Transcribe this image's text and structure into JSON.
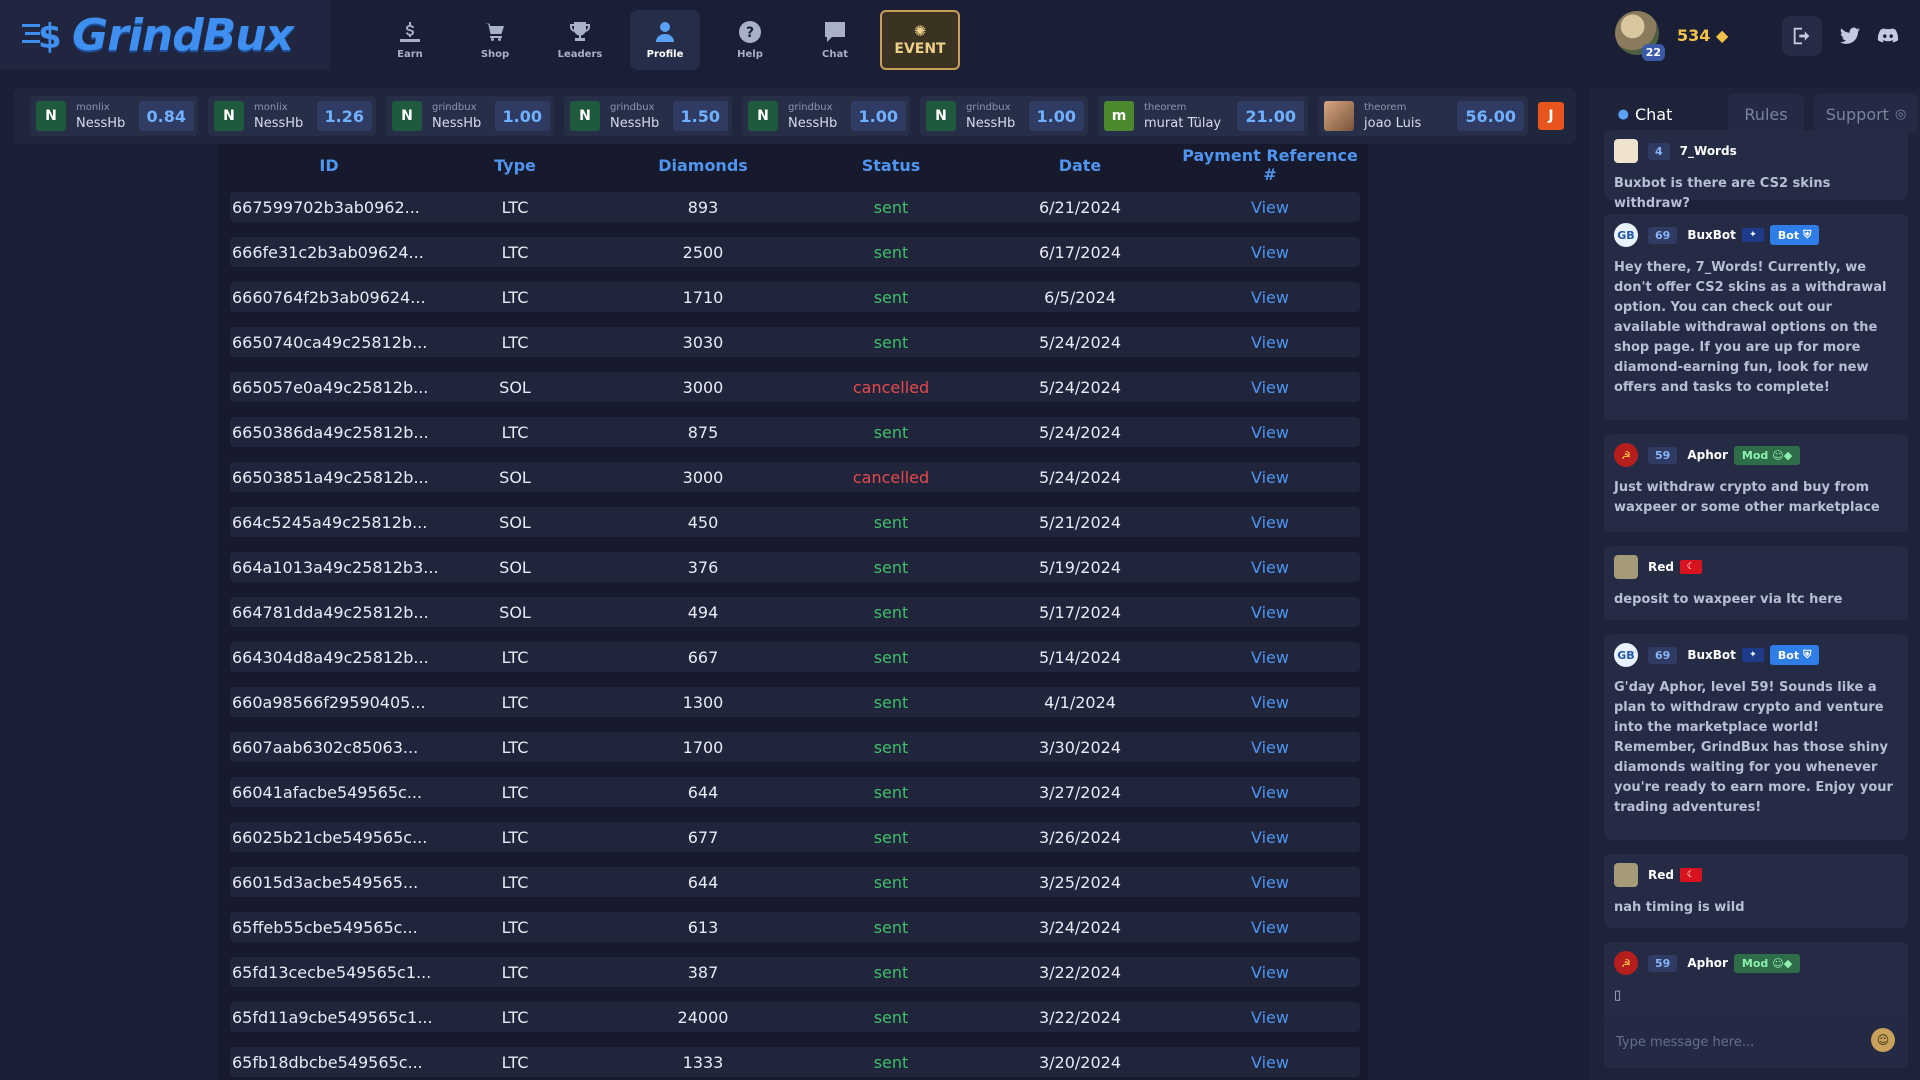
{
  "brand": {
    "name": "GrindBux"
  },
  "nav": {
    "items": [
      {
        "label": "Earn",
        "icon": "earn-icon"
      },
      {
        "label": "Shop",
        "icon": "cart-icon"
      },
      {
        "label": "Leaders",
        "icon": "trophy-icon"
      },
      {
        "label": "Profile",
        "icon": "user-icon",
        "active": true
      },
      {
        "label": "Help",
        "icon": "help-icon"
      },
      {
        "label": "Chat",
        "icon": "chat-icon"
      }
    ],
    "event_label": "EVENT"
  },
  "user": {
    "level": "22",
    "balance": "534",
    "balance_icon": "diamond-icon"
  },
  "ticker": [
    {
      "initial": "N",
      "source": "monlix",
      "user": "NessHb",
      "amount": "0.84"
    },
    {
      "initial": "N",
      "source": "monlix",
      "user": "NessHb",
      "amount": "1.26"
    },
    {
      "initial": "N",
      "source": "grindbux",
      "user": "NessHb",
      "amount": "1.00"
    },
    {
      "initial": "N",
      "source": "grindbux",
      "user": "NessHb",
      "amount": "1.50"
    },
    {
      "initial": "N",
      "source": "grindbux",
      "user": "NessHb",
      "amount": "1.00"
    },
    {
      "initial": "N",
      "source": "grindbux",
      "user": "NessHb",
      "amount": "1.00"
    },
    {
      "initial": "m",
      "source": "theorem",
      "user": "murat Tülay",
      "amount": "21.00"
    },
    {
      "initial": "",
      "source": "theorem",
      "user": "joao Luis",
      "amount": "56.00"
    }
  ],
  "ticker_last_initial": "J",
  "table": {
    "headers": [
      "ID",
      "Type",
      "Diamonds",
      "Status",
      "Date",
      "Payment Reference #"
    ],
    "rows": [
      {
        "id": "667599702b3ab0962...",
        "type": "LTC",
        "diamonds": "893",
        "status": "sent",
        "date": "6/21/2024",
        "ref": "View"
      },
      {
        "id": "666fe31c2b3ab09624...",
        "type": "LTC",
        "diamonds": "2500",
        "status": "sent",
        "date": "6/17/2024",
        "ref": "View"
      },
      {
        "id": "6660764f2b3ab09624...",
        "type": "LTC",
        "diamonds": "1710",
        "status": "sent",
        "date": "6/5/2024",
        "ref": "View"
      },
      {
        "id": "6650740ca49c25812b...",
        "type": "LTC",
        "diamonds": "3030",
        "status": "sent",
        "date": "5/24/2024",
        "ref": "View"
      },
      {
        "id": "665057e0a49c25812b...",
        "type": "SOL",
        "diamonds": "3000",
        "status": "cancelled",
        "date": "5/24/2024",
        "ref": "View"
      },
      {
        "id": "6650386da49c25812b...",
        "type": "LTC",
        "diamonds": "875",
        "status": "sent",
        "date": "5/24/2024",
        "ref": "View"
      },
      {
        "id": "66503851a49c25812b...",
        "type": "SOL",
        "diamonds": "3000",
        "status": "cancelled",
        "date": "5/24/2024",
        "ref": "View"
      },
      {
        "id": "664c5245a49c25812b...",
        "type": "SOL",
        "diamonds": "450",
        "status": "sent",
        "date": "5/21/2024",
        "ref": "View"
      },
      {
        "id": "664a1013a49c25812b3...",
        "type": "SOL",
        "diamonds": "376",
        "status": "sent",
        "date": "5/19/2024",
        "ref": "View"
      },
      {
        "id": "664781dda49c25812b...",
        "type": "SOL",
        "diamonds": "494",
        "status": "sent",
        "date": "5/17/2024",
        "ref": "View"
      },
      {
        "id": "664304d8a49c25812b...",
        "type": "LTC",
        "diamonds": "667",
        "status": "sent",
        "date": "5/14/2024",
        "ref": "View"
      },
      {
        "id": "660a98566f29590405...",
        "type": "LTC",
        "diamonds": "1300",
        "status": "sent",
        "date": "4/1/2024",
        "ref": "View"
      },
      {
        "id": "6607aab6302c85063...",
        "type": "LTC",
        "diamonds": "1700",
        "status": "sent",
        "date": "3/30/2024",
        "ref": "View"
      },
      {
        "id": "66041afacbe549565c...",
        "type": "LTC",
        "diamonds": "644",
        "status": "sent",
        "date": "3/27/2024",
        "ref": "View"
      },
      {
        "id": "66025b21cbe549565c...",
        "type": "LTC",
        "diamonds": "677",
        "status": "sent",
        "date": "3/26/2024",
        "ref": "View"
      },
      {
        "id": "66015d3acbe549565...",
        "type": "LTC",
        "diamonds": "644",
        "status": "sent",
        "date": "3/25/2024",
        "ref": "View"
      },
      {
        "id": "65ffeb55cbe549565c...",
        "type": "LTC",
        "diamonds": "613",
        "status": "sent",
        "date": "3/24/2024",
        "ref": "View"
      },
      {
        "id": "65fd13cecbe549565c1...",
        "type": "LTC",
        "diamonds": "387",
        "status": "sent",
        "date": "3/22/2024",
        "ref": "View"
      },
      {
        "id": "65fd11a9cbe549565c1...",
        "type": "LTC",
        "diamonds": "24000",
        "status": "sent",
        "date": "3/22/2024",
        "ref": "View"
      },
      {
        "id": "65fb18dbcbe549565c...",
        "type": "LTC",
        "diamonds": "1333",
        "status": "sent",
        "date": "3/20/2024",
        "ref": "View"
      }
    ]
  },
  "chat": {
    "tabs": {
      "chat": "Chat",
      "rules": "Rules",
      "support": "Support"
    },
    "messages": [
      {
        "avatar": "words",
        "level": "4",
        "name": "7_Words",
        "text": "Buxbot is there are CS2 skins withdraw?"
      },
      {
        "avatar": "bot",
        "level": "69",
        "name": "BuxBot",
        "flag": "au",
        "tag": "Bot",
        "text": "Hey there, 7_Words! Currently, we don't offer CS2 skins as a withdrawal option. You can check out our available withdrawal options on the shop page. If you are up for more diamond-earning fun, look for new offers and tasks to complete!"
      },
      {
        "avatar": "aphor",
        "level": "59",
        "name": "Aphor",
        "tag": "Mod",
        "text": "Just withdraw crypto and buy from waxpeer or some other marketplace"
      },
      {
        "avatar": "red",
        "name": "Red",
        "flag": "tr",
        "text": "deposit to waxpeer via ltc here"
      },
      {
        "avatar": "bot",
        "level": "69",
        "name": "BuxBot",
        "flag": "au",
        "tag": "Bot",
        "text": "G'day Aphor, level 59! Sounds like a plan to withdraw crypto and venture into the marketplace world! Remember, GrindBux has those shiny diamonds waiting for you whenever you're ready to earn more. Enjoy your trading adventures!"
      },
      {
        "avatar": "red",
        "name": "Red",
        "flag": "tr",
        "text": "nah timing is wild"
      },
      {
        "avatar": "aphor",
        "level": "59",
        "name": "Aphor",
        "tag": "Mod",
        "text": "▯"
      }
    ],
    "input_placeholder": "Type message here..."
  },
  "colors": {
    "accent": "#4f95ef",
    "sent": "#3fbf6a",
    "cancelled": "#e64a4a",
    "diamond": "#f3c24a"
  }
}
